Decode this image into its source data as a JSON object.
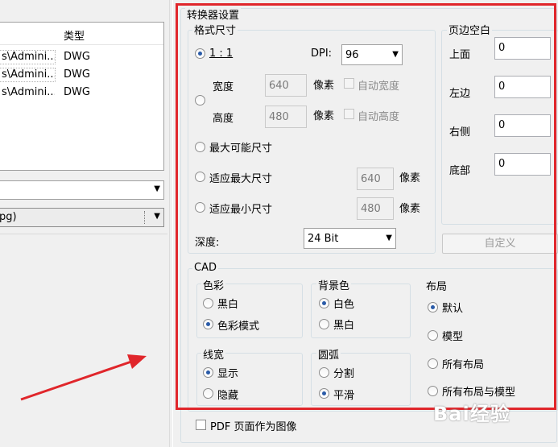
{
  "file_list": {
    "col_type": "类型",
    "rows": [
      {
        "path": "s\\Admini...",
        "type": "DWG"
      },
      {
        "path": "s\\Admini...",
        "type": "DWG"
      },
      {
        "path": "s\\Admini...",
        "type": "DWG"
      }
    ]
  },
  "left_combo_1": {
    "value": ""
  },
  "left_combo_2": {
    "value": "pg)"
  },
  "converter": {
    "title": "转换器设置",
    "format": {
      "title": "格式尺寸",
      "ratio_label": "1 : 1",
      "dpi_label": "DPI:",
      "dpi_value": "96",
      "width_label": "宽度",
      "width_value": "640",
      "height_label": "高度",
      "height_value": "480",
      "pixel_unit": "像素",
      "auto_width": "自动宽度",
      "auto_height": "自动高度",
      "max_possible": "最大可能尺寸",
      "fit_max": "适应最大尺寸",
      "fit_max_value": "640",
      "fit_min": "适应最小尺寸",
      "fit_min_value": "480",
      "depth_label": "深度:",
      "depth_value": "24 Bit"
    },
    "margins": {
      "title": "页边空白",
      "top_label": "上面",
      "top_value": "0",
      "left_label": "左边",
      "left_value": "0",
      "right_label": "右侧",
      "right_value": "0",
      "bottom_label": "底部",
      "bottom_value": "0",
      "custom_button": "自定义"
    },
    "cad": {
      "title": "CAD",
      "color": {
        "title": "色彩",
        "bw": "黑白",
        "color_mode": "色彩模式"
      },
      "background": {
        "title": "背景色",
        "white": "白色",
        "black": "黑白"
      },
      "layout": {
        "title": "布局",
        "default": "默认",
        "model": "模型",
        "all_layouts": "所有布局",
        "all_layouts_model": "所有布局与模型"
      },
      "lineweight": {
        "title": "线宽",
        "show": "显示",
        "hide": "隐藏"
      },
      "arc": {
        "title": "圆弧",
        "split": "分割",
        "smooth": "平滑"
      }
    },
    "pdf_as_image": "PDF 页面作为图像"
  },
  "watermark": "Bai经验",
  "colors": {
    "highlight_frame": "#e0262b",
    "annotation_arrow": "#e0262b",
    "radio_dot": "#2a5ba8"
  },
  "icons": [
    "dropdown-arrow-icon",
    "red-annotation-arrow-icon"
  ]
}
